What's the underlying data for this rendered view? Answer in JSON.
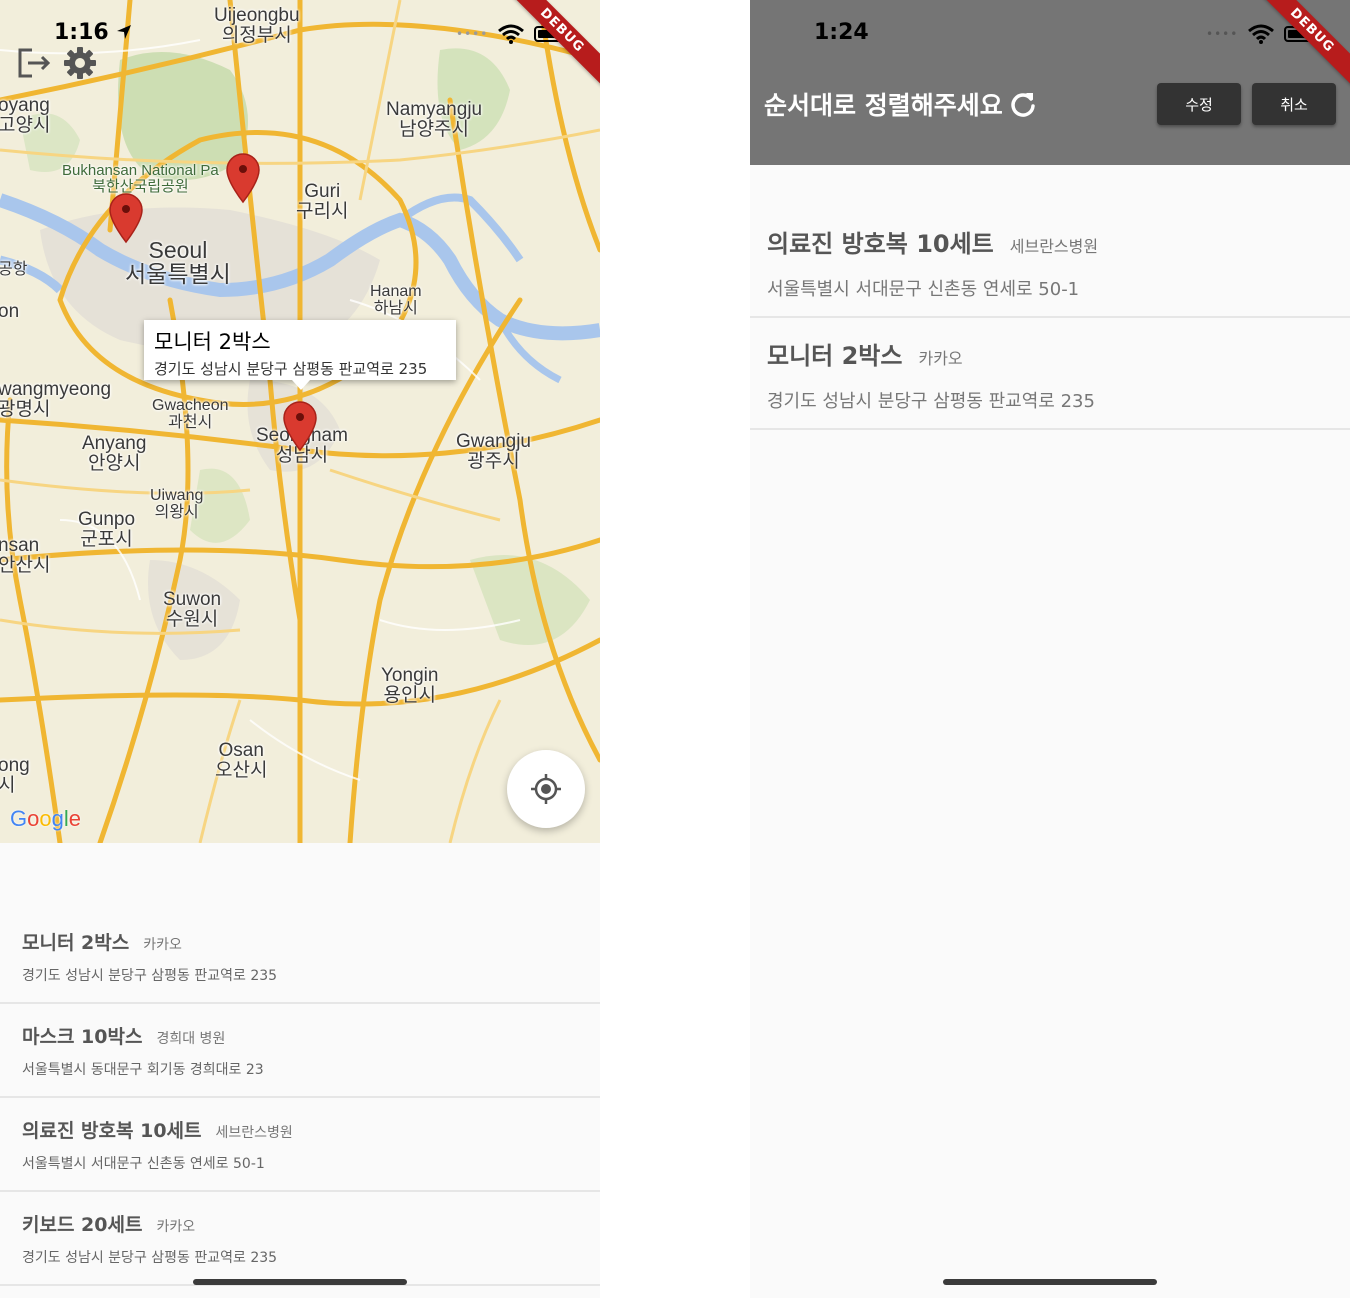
{
  "left_screen": {
    "status_time": "1:16",
    "debug_label": "DEBUG",
    "map": {
      "labels": [
        {
          "en": "Uijeongbu",
          "ko": "의정부시"
        },
        {
          "en": "oyang",
          "ko": "고양시"
        },
        {
          "en": "Namyangju",
          "ko": "남양주시"
        },
        {
          "en": "Bukhansan National Pa",
          "ko": "북한산국립공원"
        },
        {
          "en": "Guri",
          "ko": "구리시"
        },
        {
          "en": "Seoul",
          "ko": "서울특별시"
        },
        {
          "en": "",
          "ko": "공항"
        },
        {
          "en": "Hanam",
          "ko": "하남시"
        },
        {
          "en": "on",
          "ko": ""
        },
        {
          "en": "wangmyeong",
          "ko": "광명시"
        },
        {
          "en": "Gwacheon",
          "ko": "과천시"
        },
        {
          "en": "Anyang",
          "ko": "안양시"
        },
        {
          "en": "Seongnam",
          "ko": "성남시"
        },
        {
          "en": "Gwangju",
          "ko": "광주시"
        },
        {
          "en": "Uiwang",
          "ko": "의왕시"
        },
        {
          "en": "Gunpo",
          "ko": "군포시"
        },
        {
          "en": "nsan",
          "ko": "안산시"
        },
        {
          "en": "Suwon",
          "ko": "수원시"
        },
        {
          "en": "Yongin",
          "ko": "용인시"
        },
        {
          "en": "Osan",
          "ko": "오산시"
        },
        {
          "en": "ong",
          "ko": "시"
        }
      ],
      "info_window": {
        "title": "모니터 2박스",
        "address": "경기도 성남시 분당구 삼평동 판교역로 235"
      },
      "google_logo": [
        "G",
        "o",
        "o",
        "g",
        "l",
        "e"
      ],
      "marker_color": "#d93a2f"
    },
    "items": [
      {
        "name": "모니터 2박스",
        "org": "카카오",
        "address": "경기도 성남시 분당구 삼평동 판교역로 235"
      },
      {
        "name": "마스크 10박스",
        "org": "경희대 병원",
        "address": "서울특별시 동대문구 회기동 경희대로 23"
      },
      {
        "name": "의료진 방호복 10세트",
        "org": "세브란스병원",
        "address": "서울특별시 서대문구 신촌동 연세로 50-1"
      },
      {
        "name": "키보드 20세트",
        "org": "카카오",
        "address": "경기도 성남시 분당구 삼평동 판교역로 235"
      }
    ]
  },
  "right_screen": {
    "status_time": "1:24",
    "debug_label": "DEBUG",
    "app_bar": {
      "title": "순서대로 정렬해주세요",
      "edit_label": "수정",
      "cancel_label": "취소",
      "background": "#757575",
      "button_color": "#333333"
    },
    "items": [
      {
        "name": "의료진 방호복 10세트",
        "org": "세브란스병원",
        "address": "서울특별시 서대문구 신촌동 연세로 50-1"
      },
      {
        "name": "모니터 2박스",
        "org": "카카오",
        "address": "경기도 성남시 분당구 삼평동 판교역로 235"
      }
    ]
  }
}
